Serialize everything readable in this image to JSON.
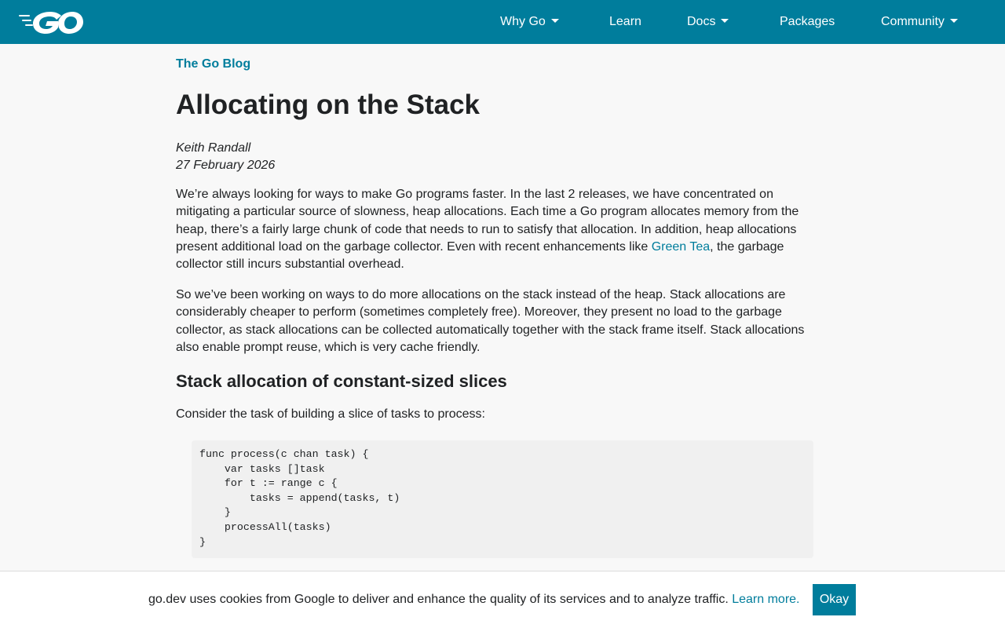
{
  "header": {
    "logo_alt": "Go",
    "nav": [
      {
        "label": "Why Go",
        "has_dropdown": true
      },
      {
        "label": "Learn",
        "has_dropdown": false
      },
      {
        "label": "Docs",
        "has_dropdown": true
      },
      {
        "label": "Packages",
        "has_dropdown": false
      },
      {
        "label": "Community",
        "has_dropdown": true
      }
    ],
    "brand_color": "#007d9c"
  },
  "article": {
    "breadcrumb": "The Go Blog",
    "title": "Allocating on the Stack",
    "author": "Keith Randall",
    "date": "27 February 2026",
    "p1_before": "We’re always looking for ways to make Go programs faster. In the last 2 releases, we have concentrated on mitigating a particular source of slowness, heap allocations. Each time a Go program allocates memory from the heap, there’s a fairly large chunk of code that needs to run to satisfy that allocation. In addition, heap allocations present additional load on the garbage collector. Even with recent enhancements like ",
    "p1_link": "Green Tea",
    "p1_after": ", the garbage collector still incurs substantial overhead.",
    "p2": "So we’ve been working on ways to do more allocations on the stack instead of the heap. Stack allocations are considerably cheaper to perform (sometimes completely free). Moreover, they present no load to the garbage collector, as stack allocations can be collected automatically together with the stack frame itself. Stack allocations also enable prompt reuse, which is very cache friendly.",
    "h2": "Stack allocation of constant-sized slices",
    "p3": "Consider the task of building a slice of tasks to process:",
    "code": "func process(c chan task) {\n    var tasks []task\n    for t := range c {\n        tasks = append(tasks, t)\n    }\n    processAll(tasks)\n}"
  },
  "cookie": {
    "text": "go.dev uses cookies from Google to deliver and enhance the quality of its services and to analyze traffic. ",
    "link": "Learn more.",
    "button": "Okay"
  }
}
